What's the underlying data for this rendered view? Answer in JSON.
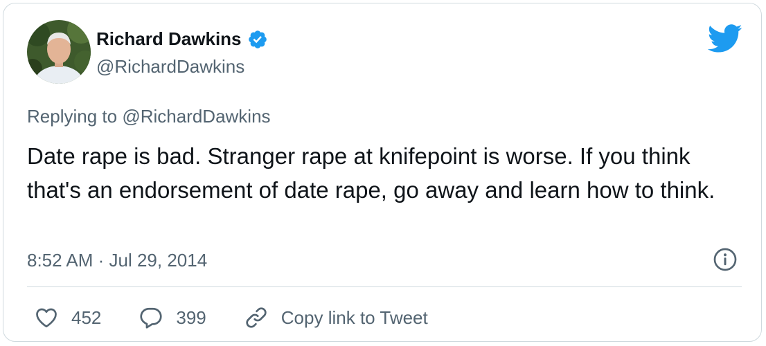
{
  "tweet": {
    "author": {
      "name": "Richard Dawkins",
      "handle": "@RichardDawkins",
      "verified": true
    },
    "reply": {
      "prefix": "Replying to",
      "to": "@RichardDawkins"
    },
    "text": "Date rape is bad. Stranger rape at knifepoint is worse. If you think that's an endorsement of date rape, go away and learn how to think.",
    "timestamp": "8:52 AM · Jul 29, 2014",
    "actions": {
      "likes": "452",
      "replies": "399",
      "copy_link_label": "Copy link to Tweet"
    }
  },
  "icons": [
    "twitter-bird-icon",
    "verified-badge-icon",
    "info-icon",
    "heart-icon",
    "reply-bubble-icon",
    "link-icon"
  ],
  "colors": {
    "brand_blue": "#1d9bf0",
    "text_primary": "#0f1419",
    "text_secondary": "#536471",
    "border": "#cfd9de"
  }
}
